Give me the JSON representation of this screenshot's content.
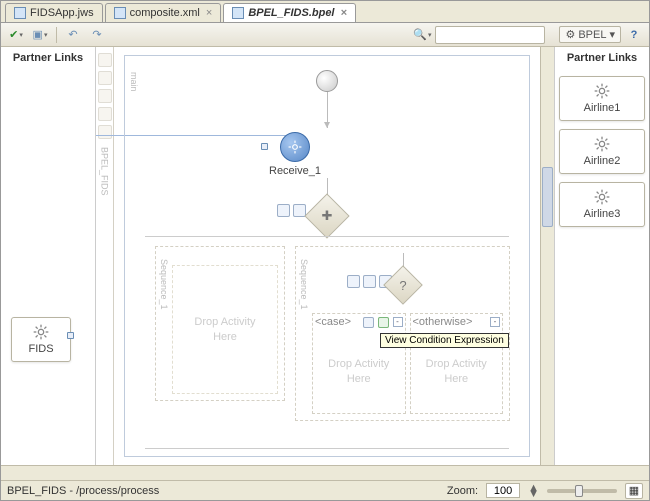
{
  "tabs": [
    {
      "label": "FIDSApp.jws",
      "active": false
    },
    {
      "label": "composite.xml",
      "active": false
    },
    {
      "label": "BPEL_FIDS.bpel",
      "active": true
    }
  ],
  "toolbar": {
    "bpel_label": "BPEL",
    "search_placeholder": ""
  },
  "partner_links": {
    "heading": "Partner Links",
    "left": [
      {
        "name": "FIDS"
      }
    ],
    "right": [
      {
        "name": "Airline1"
      },
      {
        "name": "Airline2"
      },
      {
        "name": "Airline3"
      }
    ]
  },
  "canvas": {
    "side_label": "BPEL_FIDS",
    "main_label": "main",
    "receive_label": "Receive_1",
    "sequence_label": "Sequence_1",
    "drop_text_1": "Drop Activity",
    "drop_text_2": "Here",
    "case_label": "<case>",
    "otherwise_label": "<otherwise>",
    "tooltip": "View Condition Expression"
  },
  "status": {
    "path": "BPEL_FIDS - /process/process",
    "zoom_label": "Zoom:",
    "zoom_value": "100"
  }
}
